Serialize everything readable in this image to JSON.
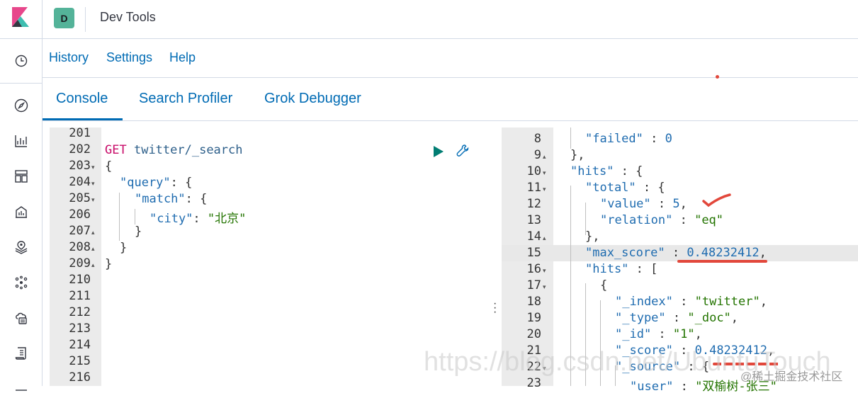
{
  "header": {
    "avatar_letter": "D",
    "app_title": "Dev Tools"
  },
  "sidenav": {
    "icons": [
      "clock-icon",
      "compass-icon",
      "visualize-icon",
      "dashboard-icon",
      "canvas-icon",
      "maps-icon",
      "ml-icon",
      "stack-monitoring-icon",
      "logs-icon"
    ]
  },
  "subnav": {
    "history": "History",
    "settings": "Settings",
    "help": "Help"
  },
  "tabs": {
    "console": "Console",
    "search_profiler": "Search Profiler",
    "grok_debugger": "Grok Debugger"
  },
  "request_editor": {
    "line_numbers": [
      "201",
      "202",
      "203",
      "204",
      "205",
      "206",
      "207",
      "208",
      "209",
      "210",
      "211",
      "212",
      "213",
      "214",
      "215",
      "216"
    ],
    "method": "GET",
    "path": "twitter/_search",
    "open_brace": "{",
    "query_key": "\"query\"",
    "match_key": "\"match\"",
    "city_key": "\"city\"",
    "city_value": "\"北京\"",
    "close_inner": "}",
    "close_mid": "}",
    "close_outer": "}"
  },
  "response_viewer": {
    "line_numbers": [
      "8",
      "9",
      "10",
      "11",
      "12",
      "13",
      "14",
      "15",
      "16",
      "17",
      "18",
      "19",
      "20",
      "21",
      "22",
      "23"
    ],
    "failed_key": "\"failed\"",
    "failed_value": "0",
    "hits_key": "\"hits\"",
    "total_key": "\"total\"",
    "value_key": "\"value\"",
    "value_value": "5",
    "relation_key": "\"relation\"",
    "relation_value": "\"eq\"",
    "max_score_key": "\"max_score\"",
    "max_score_value": "0.48232412",
    "inner_hits_key": "\"hits\"",
    "index_key": "\"_index\"",
    "index_value": "\"twitter\"",
    "type_key": "\"_type\"",
    "type_value": "\"_doc\"",
    "id_key": "\"_id\"",
    "id_value": "\"1\"",
    "score_key": "\"_score\"",
    "score_value": "0.48232412",
    "source_key": "\"_source\"",
    "user_key": "\"user\"",
    "user_value": "\"双榆树-张三\""
  },
  "overlay": {
    "watermark": "https://blog.csdn.net/UbuntuTouch",
    "credit": "@稀土掘金技术社区"
  },
  "colors": {
    "accent": "#006bb4",
    "method": "#c80a68",
    "string": "#237400",
    "annotation": "#e2473b"
  }
}
